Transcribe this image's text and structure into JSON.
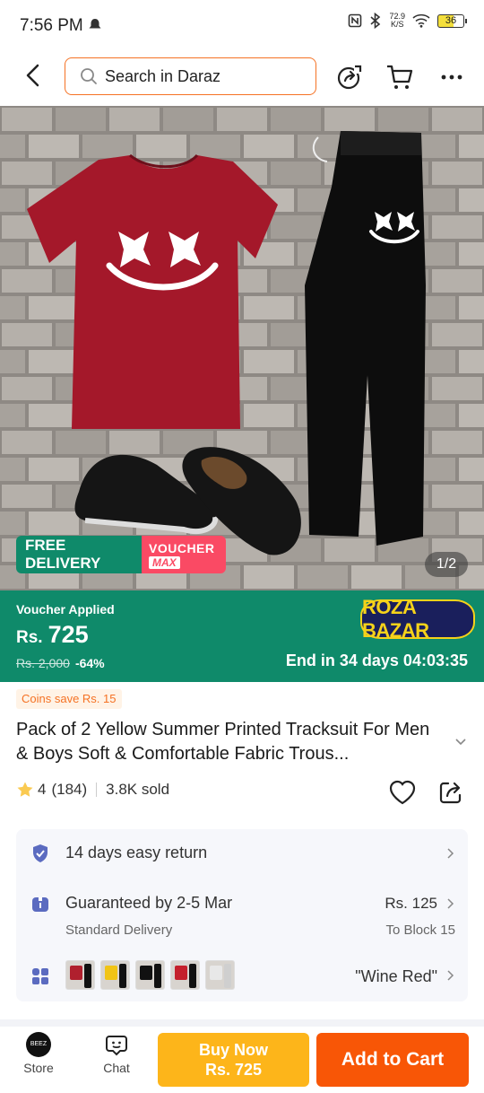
{
  "status": {
    "time": "7:56 PM",
    "net_speed": "72.9",
    "net_unit": "K/S",
    "battery": "36"
  },
  "header": {
    "search_placeholder": "Search in Daraz"
  },
  "hero": {
    "free_delivery": "FREE DELIVERY",
    "voucher": "VOUCHER",
    "voucher_max": "MAX",
    "counter": "1/2"
  },
  "voucher_band": {
    "label": "Voucher Applied",
    "currency": "Rs.",
    "price": "725",
    "old_price": "Rs. 2,000",
    "discount": "-64%",
    "store_logo": "ROZA BAZAR",
    "countdown": "End in 34 days 04:03:35"
  },
  "coins": "Coins save Rs. 15",
  "product": {
    "title": "Pack of 2  Yellow Summer Printed Tracksuit For Men & Boys  Soft & Comfortable Fabric Trous...",
    "rating": "4",
    "reviews": "(184)",
    "sold": "3.8K sold"
  },
  "info": {
    "return": "14 days easy return",
    "delivery": "Guaranteed by 2-5 Mar",
    "delivery_price": "Rs. 125",
    "delivery_type": "Standard Delivery",
    "delivery_to": "To Block 15",
    "variant": "\"Wine Red\""
  },
  "variants": [
    {
      "name": "wine-red",
      "top": "#b0202e",
      "bottom": "#111111"
    },
    {
      "name": "yellow",
      "top": "#f1c416",
      "bottom": "#111111"
    },
    {
      "name": "black",
      "top": "#111111",
      "bottom": "#111111"
    },
    {
      "name": "red",
      "top": "#c4202c",
      "bottom": "#111111"
    },
    {
      "name": "white",
      "top": "#e8e8e8",
      "bottom": "#cfcfcf"
    }
  ],
  "bottom_bar": {
    "store_label": "Store",
    "store_avatar": "BEEZ",
    "chat_label": "Chat",
    "buy_now": "Buy Now",
    "buy_now_price": "Rs. 725",
    "add_to_cart": "Add to Cart"
  },
  "colors": {
    "accent": "#f57224",
    "voucher_green": "#0f8a6a",
    "buy_now": "#fdb51a",
    "add_to_cart": "#f85606"
  }
}
